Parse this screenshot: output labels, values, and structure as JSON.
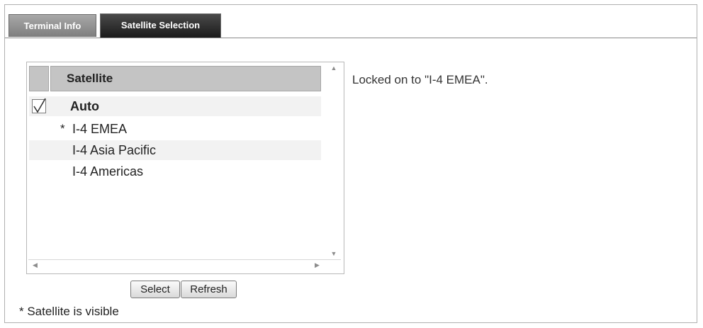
{
  "tabs": [
    {
      "label": "Terminal Info",
      "active": false
    },
    {
      "label": "Satellite Selection",
      "active": true
    }
  ],
  "grid": {
    "column_header": "Satellite",
    "rows": [
      {
        "checked": true,
        "visible_marker": "",
        "name": "Auto",
        "bold": true
      },
      {
        "checked": false,
        "visible_marker": "*",
        "name": "I-4 EMEA",
        "bold": false
      },
      {
        "checked": false,
        "visible_marker": "",
        "name": "I-4 Asia Pacific",
        "bold": false
      },
      {
        "checked": false,
        "visible_marker": "",
        "name": "I-4 Americas",
        "bold": false
      }
    ]
  },
  "buttons": {
    "select_label": "Select",
    "refresh_label": "Refresh"
  },
  "footnote": "* Satellite is visible",
  "status_message": "Locked on to \"I-4 EMEA\".",
  "icons": {
    "checkmark": "checkmark-icon",
    "scroll_up": "scroll-up-icon",
    "scroll_down": "scroll-down-icon",
    "scroll_left": "scroll-left-icon",
    "scroll_right": "scroll-right-icon"
  }
}
